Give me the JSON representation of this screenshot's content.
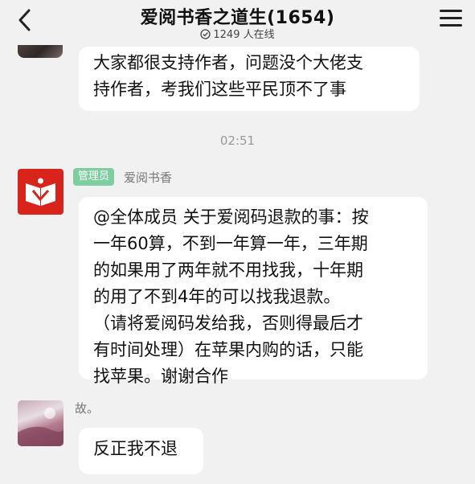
{
  "header": {
    "title": "爱阅书香之道生(1654)",
    "online": "1249 人在线"
  },
  "messages": [
    {
      "lines": [
        "大家都很支持作者，问题没个大佬支",
        "持作者，考我们这些平民顶不了事"
      ]
    }
  ],
  "timestamp": "02:51",
  "admin_message": {
    "badge": "管理员",
    "sender": "爱阅书香",
    "lines": [
      "@全体成员 关于爱阅码退款的事：按",
      "一年60算，不到一年算一年，三年期",
      "的如果用了两年就不用找我，十年期",
      "的用了不到4年的可以找我退款。",
      "（请将爱阅码发给我，否则得最后才",
      "有时间处理）在苹果内购的话，只能",
      "找苹果。谢谢合作"
    ]
  },
  "user_message": {
    "sender": "故。",
    "text": "反正我不退"
  },
  "colors": {
    "admin_badge": "#7ecfa0",
    "admin_avatar": "#d9241c",
    "background": "#f1f1f1"
  }
}
